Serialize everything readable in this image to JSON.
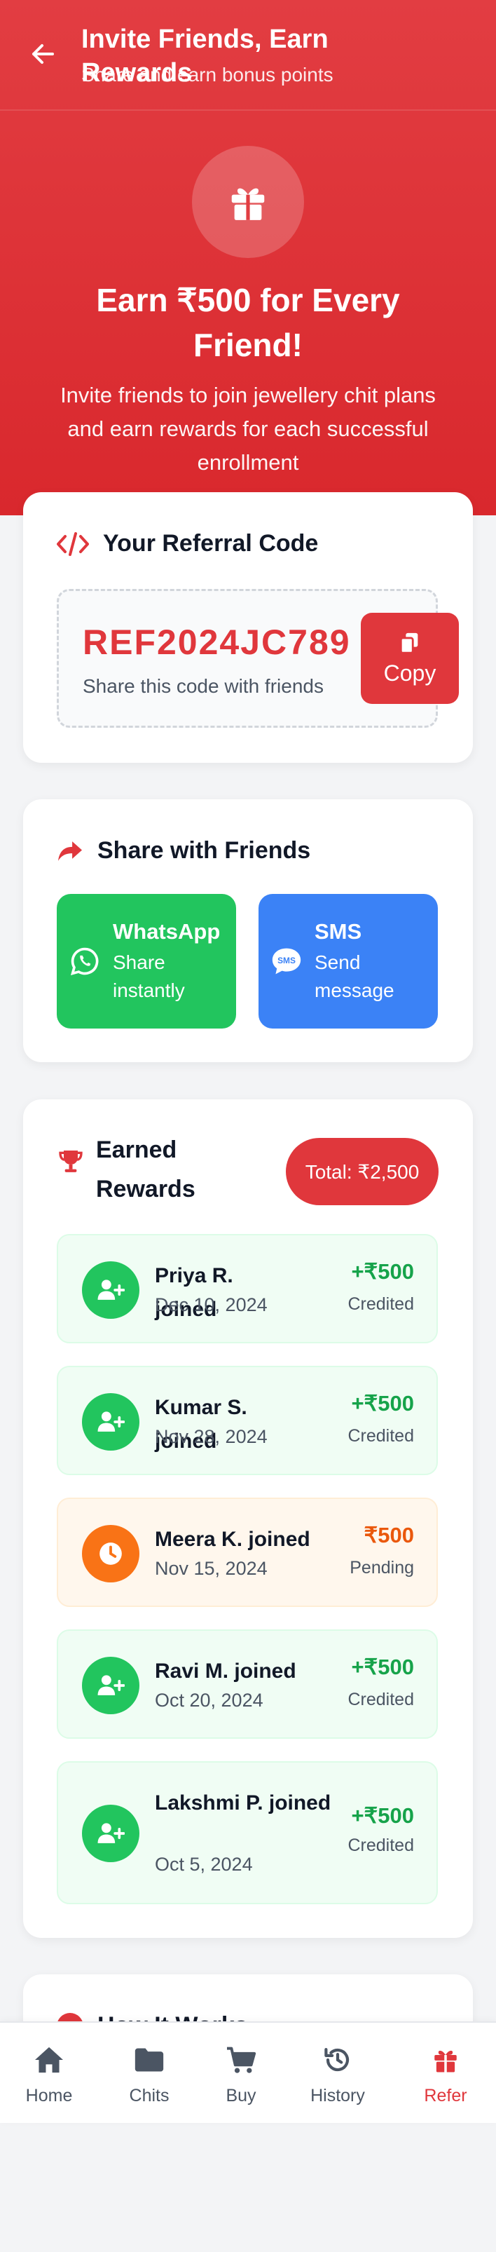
{
  "header": {
    "title": "Invite Friends, Earn Rewards",
    "subtitle": "Share and earn bonus points"
  },
  "hero": {
    "title": "Earn ₹500 for Every Friend!",
    "subtitle": "Invite friends to join jewellery chit plans and earn rewards for each successful enrollment"
  },
  "referral": {
    "title": "Your Referral Code",
    "code": "REF2024JC789",
    "hint": "Share this code with friends",
    "copy_label": "Copy"
  },
  "share": {
    "title": "Share with Friends",
    "whatsapp_label": "WhatsApp",
    "whatsapp_sub": "Share instantly",
    "sms_label": "SMS",
    "sms_sub": "Send message"
  },
  "rewards": {
    "title": "Earned Rewards",
    "total": "Total: ₹2,500",
    "items": [
      {
        "name": "Priya R. joined",
        "date": "Dec 10, 2024",
        "amount": "+₹500",
        "status": "Credited"
      },
      {
        "name": "Kumar S. joined",
        "date": "Nov 28, 2024",
        "amount": "+₹500",
        "status": "Credited"
      },
      {
        "name": "Meera K. joined",
        "date": "Nov 15, 2024",
        "amount": "₹500",
        "status": "Pending"
      },
      {
        "name": "Ravi M. joined",
        "date": "Oct 20, 2024",
        "amount": "+₹500",
        "status": "Credited"
      },
      {
        "name": "Lakshmi P. joined",
        "date": "Oct 5, 2024",
        "amount": "+₹500",
        "status": "Credited"
      }
    ]
  },
  "how_it_works": {
    "title": "How It Works"
  },
  "nav": {
    "items": [
      {
        "label": "Home",
        "icon": "home-icon"
      },
      {
        "label": "Chits",
        "icon": "folder-icon"
      },
      {
        "label": "Buy",
        "icon": "cart-icon"
      },
      {
        "label": "History",
        "icon": "history-icon"
      },
      {
        "label": "Refer",
        "icon": "gift-icon"
      }
    ],
    "active": "Refer"
  },
  "colors": {
    "brand_red": "#e0373c",
    "whatsapp_green": "#22c55e",
    "sms_blue": "#3b82f6",
    "pending_orange": "#f97316",
    "credited_green": "#16a34a"
  }
}
